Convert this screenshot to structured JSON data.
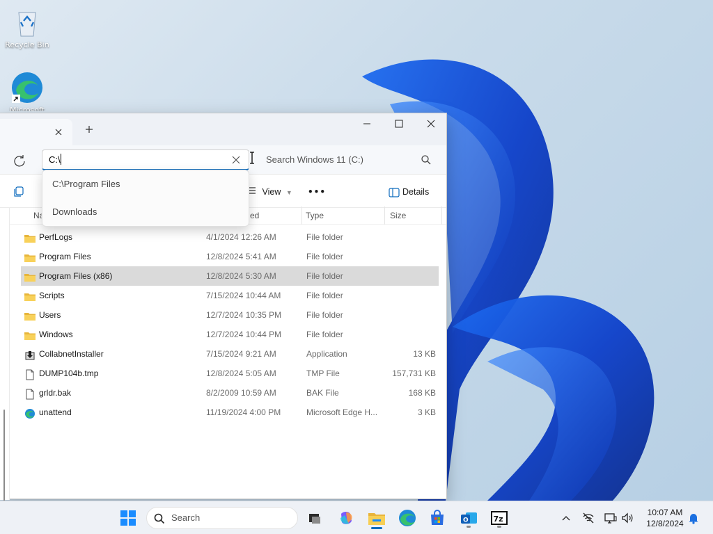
{
  "desktop": {
    "icons": [
      {
        "label": "Recycle Bin",
        "icon": "recycle-bin-icon"
      },
      {
        "label": "Microsoft Edge",
        "icon": "edge-icon"
      }
    ]
  },
  "window": {
    "tab_close_icon": "close-icon",
    "new_tab_icon": "plus-icon",
    "controls": [
      "minimize-icon",
      "maximize-icon",
      "close-icon"
    ]
  },
  "address_bar": {
    "value": "C:\\",
    "search_placeholder": "Search Windows 11 (C:)",
    "suggestions": [
      "C:\\Program Files",
      "Downloads"
    ]
  },
  "command_bar": {
    "view_label": "View",
    "more_label": "•••",
    "details_label": "Details"
  },
  "columns": {
    "name": "Na",
    "date": "ed",
    "type": "Type",
    "size": "Size"
  },
  "files": [
    {
      "name": "PerfLogs",
      "date": "4/1/2024 12:26 AM",
      "type": "File folder",
      "size": "",
      "icon": "folder-icon"
    },
    {
      "name": "Program Files",
      "date": "12/8/2024 5:41 AM",
      "type": "File folder",
      "size": "",
      "icon": "folder-icon"
    },
    {
      "name": "Program Files (x86)",
      "date": "12/8/2024 5:30 AM",
      "type": "File folder",
      "size": "",
      "icon": "folder-icon",
      "selected": true
    },
    {
      "name": "Scripts",
      "date": "7/15/2024 10:44 AM",
      "type": "File folder",
      "size": "",
      "icon": "folder-icon"
    },
    {
      "name": "Users",
      "date": "12/7/2024 10:35 PM",
      "type": "File folder",
      "size": "",
      "icon": "folder-icon"
    },
    {
      "name": "Windows",
      "date": "12/7/2024 10:44 PM",
      "type": "File folder",
      "size": "",
      "icon": "folder-icon"
    },
    {
      "name": "CollabnetInstaller",
      "date": "7/15/2024 9:21 AM",
      "type": "Application",
      "size": "13 KB",
      "icon": "installer-icon"
    },
    {
      "name": "DUMP104b.tmp",
      "date": "12/8/2024 5:05 AM",
      "type": "TMP File",
      "size": "157,731 KB",
      "icon": "file-icon"
    },
    {
      "name": "grldr.bak",
      "date": "8/2/2009 10:59 AM",
      "type": "BAK File",
      "size": "168 KB",
      "icon": "file-icon"
    },
    {
      "name": "unattend",
      "date": "11/19/2024 4:00 PM",
      "type": "Microsoft Edge H...",
      "size": "3 KB",
      "icon": "edge-icon"
    }
  ],
  "taskbar": {
    "search_placeholder": "Search",
    "apps": [
      "start-icon",
      "task-view-icon",
      "copilot-icon",
      "file-explorer-icon",
      "edge-icon",
      "store-icon",
      "outlook-icon",
      "7zip-icon"
    ],
    "tray": [
      "chevron-up-icon",
      "network-off-icon",
      "display-icon",
      "volume-icon",
      "bell-icon"
    ],
    "time": "10:07 AM",
    "date": "12/8/2024"
  },
  "colors": {
    "accent": "#0f6cbd",
    "folder": "#f2c94c",
    "selection": "#dadada"
  }
}
